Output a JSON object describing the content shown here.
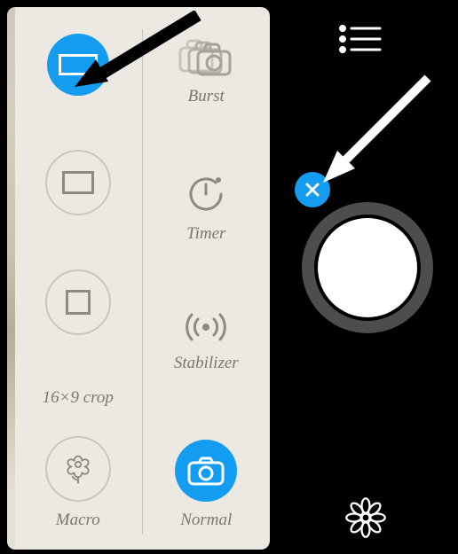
{
  "colors": {
    "accent": "#139cf0",
    "panel": "#ece9e3",
    "text": "#7b7770"
  },
  "left_panel": {
    "column_a": {
      "crop_wide": {
        "icon": "crop-16x9-icon",
        "selected": true
      },
      "crop_43": {
        "icon": "crop-4x3-icon",
        "selected": false
      },
      "crop_square": {
        "icon": "crop-square-icon",
        "selected": false
      },
      "crop_label": "16×9 crop",
      "macro": {
        "icon": "flower-icon",
        "label": "Macro"
      }
    },
    "column_b": {
      "burst": {
        "icon": "burst-icon",
        "label": "Burst"
      },
      "timer": {
        "icon": "timer-icon",
        "label": "Timer"
      },
      "stabilizer": {
        "icon": "stabilizer-icon",
        "label": "Stabilizer"
      },
      "normal": {
        "icon": "camera-icon",
        "label": "Normal",
        "selected": true
      }
    }
  },
  "right_bar": {
    "menu_icon": "list-icon",
    "close_icon": "close-icon",
    "shutter": "shutter-button",
    "effects_icon": "flower-icon"
  }
}
